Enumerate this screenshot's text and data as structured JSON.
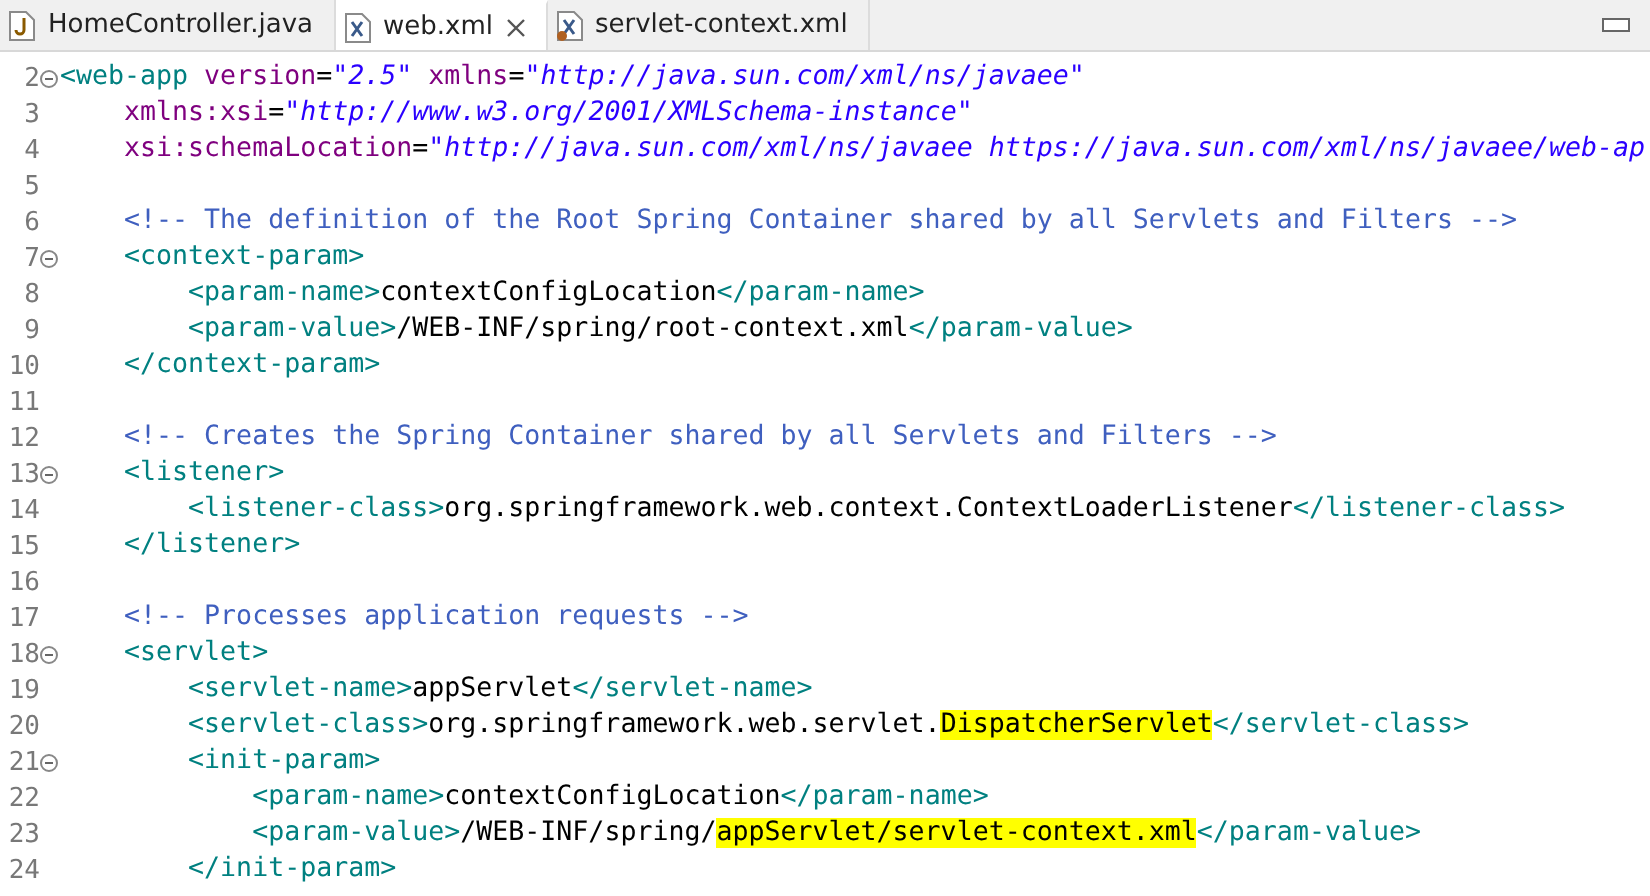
{
  "tabs": [
    {
      "label": "HomeController.java",
      "kind": "java",
      "selected": false,
      "closable": false,
      "problem": false
    },
    {
      "label": "web.xml",
      "kind": "xml",
      "selected": true,
      "closable": true,
      "problem": false
    },
    {
      "label": "servlet-context.xml",
      "kind": "xml",
      "selected": false,
      "closable": false,
      "problem": true
    }
  ],
  "lines": [
    {
      "number": "2",
      "fold": true,
      "segments": [
        {
          "kind": "tag",
          "text": "<web-app"
        },
        {
          "kind": "attr",
          "text": " version"
        },
        {
          "kind": "text",
          "text": "="
        },
        {
          "kind": "value",
          "text": "\"2.5\""
        },
        {
          "kind": "attr",
          "text": " xmlns"
        },
        {
          "kind": "text",
          "text": "="
        },
        {
          "kind": "value",
          "text": "\"http://java.sun.com/xml/ns/javaee\""
        }
      ]
    },
    {
      "number": "3",
      "fold": false,
      "segments": [
        {
          "kind": "attr",
          "text": "    xmlns:xsi"
        },
        {
          "kind": "text",
          "text": "="
        },
        {
          "kind": "value",
          "text": "\"http://www.w3.org/2001/XMLSchema-instance\""
        }
      ]
    },
    {
      "number": "4",
      "fold": false,
      "segments": [
        {
          "kind": "attr",
          "text": "    xsi:schemaLocation"
        },
        {
          "kind": "text",
          "text": "="
        },
        {
          "kind": "value",
          "text": "\"http://java.sun.com/xml/ns/javaee https://java.sun.com/xml/ns/javaee/web-ap"
        }
      ]
    },
    {
      "number": "5",
      "fold": false
    },
    {
      "number": "6",
      "fold": false,
      "segments": [
        {
          "kind": "comment",
          "text": "    <!-- The definition of the Root Spring Container shared by all Servlets and Filters -->"
        }
      ]
    },
    {
      "number": "7",
      "fold": true,
      "segments": [
        {
          "kind": "tag",
          "text": "    <context-param>"
        }
      ]
    },
    {
      "number": "8",
      "fold": false,
      "segments": [
        {
          "kind": "tag",
          "text": "        <param-name>"
        },
        {
          "kind": "text",
          "text": "contextConfigLocation"
        },
        {
          "kind": "tag",
          "text": "</param-name>"
        }
      ]
    },
    {
      "number": "9",
      "fold": false,
      "segments": [
        {
          "kind": "tag",
          "text": "        <param-value>"
        },
        {
          "kind": "text",
          "text": "/WEB-INF/spring/root-context.xml"
        },
        {
          "kind": "tag",
          "text": "</param-value>"
        }
      ]
    },
    {
      "number": "10",
      "fold": false,
      "segments": [
        {
          "kind": "tag",
          "text": "    </context-param>"
        }
      ]
    },
    {
      "number": "11",
      "fold": false
    },
    {
      "number": "12",
      "fold": false,
      "segments": [
        {
          "kind": "comment",
          "text": "    <!-- Creates the Spring Container shared by all Servlets and Filters -->"
        }
      ]
    },
    {
      "number": "13",
      "fold": true,
      "segments": [
        {
          "kind": "tag",
          "text": "    <listener>"
        }
      ]
    },
    {
      "number": "14",
      "fold": false,
      "segments": [
        {
          "kind": "tag",
          "text": "        <listener-class>"
        },
        {
          "kind": "text",
          "text": "org.springframework.web.context.ContextLoaderListener"
        },
        {
          "kind": "tag",
          "text": "</listener-class>"
        }
      ]
    },
    {
      "number": "15",
      "fold": false,
      "segments": [
        {
          "kind": "tag",
          "text": "    </listener>"
        }
      ]
    },
    {
      "number": "16",
      "fold": false
    },
    {
      "number": "17",
      "fold": false,
      "segments": [
        {
          "kind": "comment",
          "text": "    <!-- Processes application requests -->"
        }
      ]
    },
    {
      "number": "18",
      "fold": true,
      "segments": [
        {
          "kind": "tag",
          "text": "    <servlet>"
        }
      ]
    },
    {
      "number": "19",
      "fold": false,
      "segments": [
        {
          "kind": "tag",
          "text": "        <servlet-name>"
        },
        {
          "kind": "text",
          "text": "appServlet"
        },
        {
          "kind": "tag",
          "text": "</servlet-name>"
        }
      ]
    },
    {
      "number": "20",
      "fold": false,
      "segments": [
        {
          "kind": "tag",
          "text": "        <servlet-class>"
        },
        {
          "kind": "text",
          "text": "org.springframework.web.servlet."
        },
        {
          "kind": "highlight",
          "text": "DispatcherServlet"
        },
        {
          "kind": "tag",
          "text": "</servlet-class>"
        }
      ]
    },
    {
      "number": "21",
      "fold": true,
      "segments": [
        {
          "kind": "tag",
          "text": "        <init-param>"
        }
      ]
    },
    {
      "number": "22",
      "fold": false,
      "segments": [
        {
          "kind": "tag",
          "text": "            <param-name>"
        },
        {
          "kind": "text",
          "text": "contextConfigLocation"
        },
        {
          "kind": "tag",
          "text": "</param-name>"
        }
      ]
    },
    {
      "number": "23",
      "fold": false,
      "segments": [
        {
          "kind": "tag",
          "text": "            <param-value>"
        },
        {
          "kind": "text",
          "text": "/WEB-INF/spring/"
        },
        {
          "kind": "highlight",
          "text": "appServlet/servlet-context.xml"
        },
        {
          "kind": "tag",
          "text": "</param-value>"
        }
      ]
    },
    {
      "number": "24",
      "fold": false,
      "segments": [
        {
          "kind": "tag",
          "text": "        </init-param>"
        }
      ]
    }
  ]
}
